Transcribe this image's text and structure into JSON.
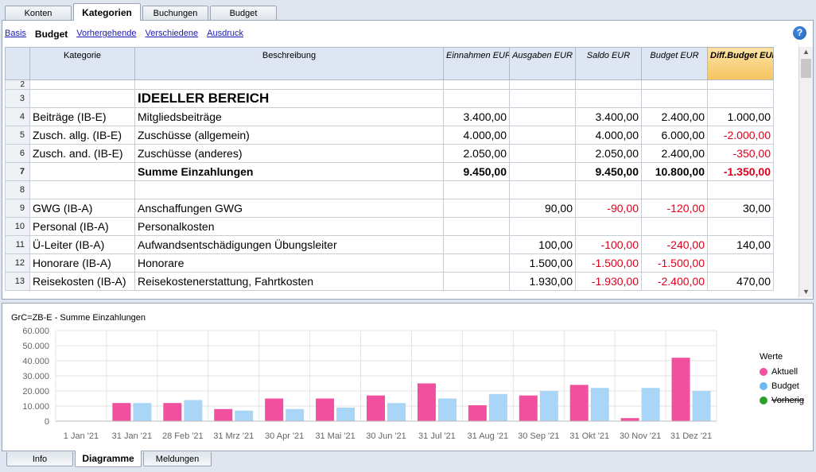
{
  "top_tabs": [
    "Konten",
    "Kategorien",
    "Buchungen",
    "Budget"
  ],
  "subnav": [
    "Basis",
    "Budget",
    "Vorhergehende",
    "Verschiedene",
    "Ausdruck"
  ],
  "help_label": "?",
  "table": {
    "headers": [
      "Kategorie",
      "Beschreibung",
      "Einnahmen EUR",
      "Ausgaben EUR",
      "Saldo EUR",
      "Budget EUR",
      "Diff.Budget EUR"
    ],
    "rows": [
      {
        "n": "2",
        "cat": "",
        "desc": "",
        "ein": "",
        "aus": "",
        "saldo": "",
        "budget": "",
        "diff": ""
      },
      {
        "n": "3",
        "cat": "",
        "desc": "IDEELLER BEREICH",
        "ein": "",
        "aus": "",
        "saldo": "",
        "budget": "",
        "diff": ""
      },
      {
        "n": "4",
        "cat": "Beiträge (IB-E)",
        "desc": "Mitgliedsbeiträge",
        "ein": "3.400,00",
        "aus": "",
        "saldo": "3.400,00",
        "budget": "2.400,00",
        "diff": "1.000,00"
      },
      {
        "n": "5",
        "cat": "Zusch. allg. (IB-E)",
        "desc": "Zuschüsse (allgemein)",
        "ein": "4.000,00",
        "aus": "",
        "saldo": "4.000,00",
        "budget": "6.000,00",
        "diff": "-2.000,00"
      },
      {
        "n": "6",
        "cat": "Zusch. and. (IB-E)",
        "desc": "Zuschüsse (anderes)",
        "ein": "2.050,00",
        "aus": "",
        "saldo": "2.050,00",
        "budget": "2.400,00",
        "diff": "-350,00"
      },
      {
        "n": "7",
        "cat": "",
        "desc": "Summe Einzahlungen",
        "ein": "9.450,00",
        "aus": "",
        "saldo": "9.450,00",
        "budget": "10.800,00",
        "diff": "-1.350,00"
      },
      {
        "n": "8",
        "cat": "",
        "desc": "",
        "ein": "",
        "aus": "",
        "saldo": "",
        "budget": "",
        "diff": ""
      },
      {
        "n": "9",
        "cat": "GWG (IB-A)",
        "desc": "Anschaffungen GWG",
        "ein": "",
        "aus": "90,00",
        "saldo": "-90,00",
        "budget": "-120,00",
        "diff": "30,00"
      },
      {
        "n": "10",
        "cat": "Personal (IB-A)",
        "desc": "Personalkosten",
        "ein": "",
        "aus": "",
        "saldo": "",
        "budget": "",
        "diff": ""
      },
      {
        "n": "11",
        "cat": "Ü-Leiter (IB-A)",
        "desc": "Aufwandsentschädigungen Übungsleiter",
        "ein": "",
        "aus": "100,00",
        "saldo": "-100,00",
        "budget": "-240,00",
        "diff": "140,00"
      },
      {
        "n": "12",
        "cat": "Honorare (IB-A)",
        "desc": "Honorare",
        "ein": "",
        "aus": "1.500,00",
        "saldo": "-1.500,00",
        "budget": "-1.500,00",
        "diff": ""
      },
      {
        "n": "13",
        "cat": "Reisekosten (IB-A)",
        "desc": "Reisekostenerstattung, Fahrtkosten",
        "ein": "",
        "aus": "1.930,00",
        "saldo": "-1.930,00",
        "budget": "-2.400,00",
        "diff": "470,00"
      }
    ]
  },
  "chart_data": {
    "type": "bar",
    "title": "GrC=ZB-E - Summe Einzahlungen",
    "categories": [
      "1 Jan '21",
      "31 Jan '21",
      "28 Feb '21",
      "31 Mrz '21",
      "30 Apr '21",
      "31 Mai '21",
      "30 Jun '21",
      "31 Jul '21",
      "31 Aug '21",
      "30 Sep '21",
      "31 Okt '21",
      "30 Nov '21",
      "31 Dez '21"
    ],
    "series": [
      {
        "name": "Aktuell",
        "color": "#f0509e",
        "values": [
          0,
          12000,
          12000,
          8000,
          15000,
          15000,
          17000,
          25000,
          10500,
          17000,
          24000,
          2000,
          42000
        ]
      },
      {
        "name": "Budget",
        "color": "#a9d5f7",
        "values": [
          0,
          12000,
          14000,
          7000,
          8000,
          9000,
          12000,
          15000,
          18000,
          20000,
          22000,
          22000,
          20000
        ]
      }
    ],
    "yticks": [
      "0",
      "10.000",
      "20.000",
      "30.000",
      "40.000",
      "50.000",
      "60.000"
    ],
    "ylim": [
      0,
      60000
    ],
    "grid": true,
    "legend_position": "right",
    "legend": {
      "title": "Werte",
      "items": [
        {
          "name": "Aktuell",
          "color": "#f0509e"
        },
        {
          "name": "Budget",
          "color": "#6bb8f3"
        },
        {
          "name": "Vorherig",
          "color": "#2ca02c"
        }
      ]
    }
  },
  "bottom_tabs": [
    "Info",
    "Diagramme",
    "Meldungen"
  ]
}
